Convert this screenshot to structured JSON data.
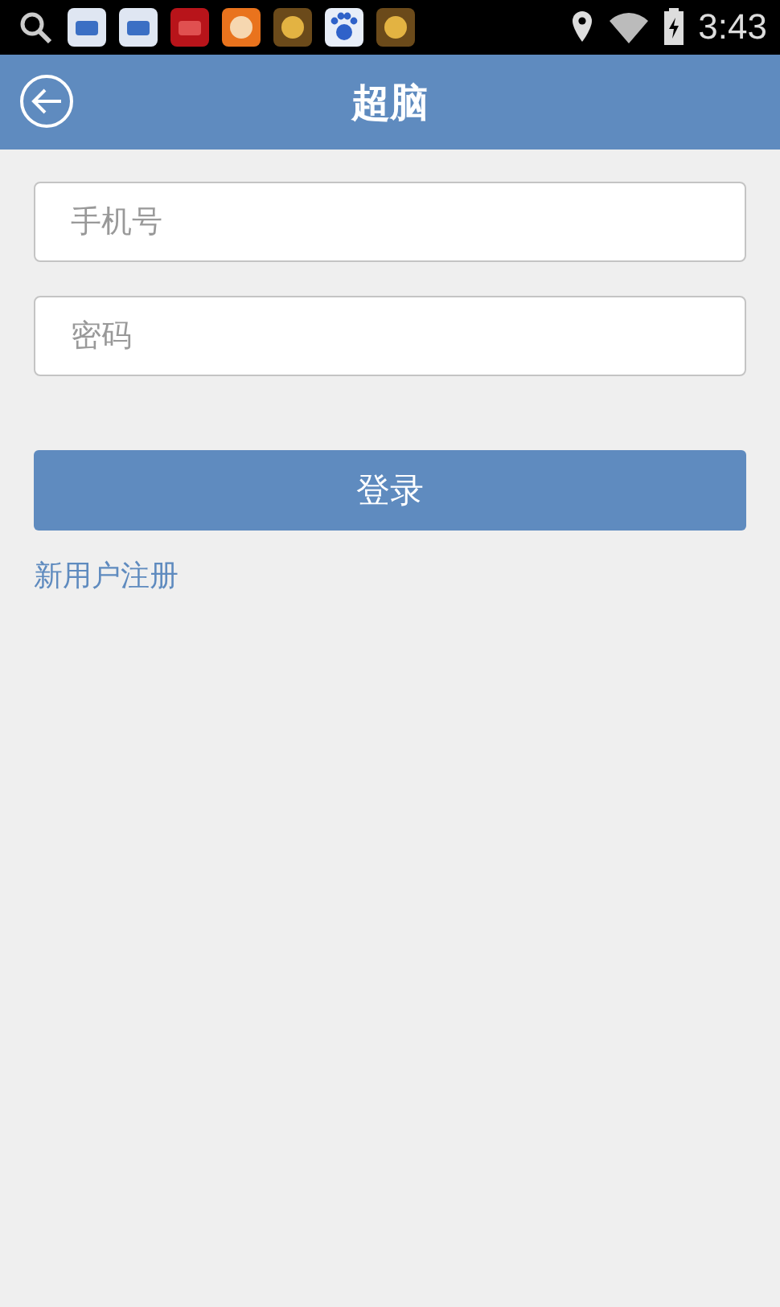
{
  "status_bar": {
    "time": "3:43"
  },
  "header": {
    "title": "超脑"
  },
  "form": {
    "fields": [
      {
        "placeholder": "手机号"
      },
      {
        "placeholder": "密码"
      }
    ],
    "login_button": "登录",
    "register_link": "新用户注册"
  }
}
